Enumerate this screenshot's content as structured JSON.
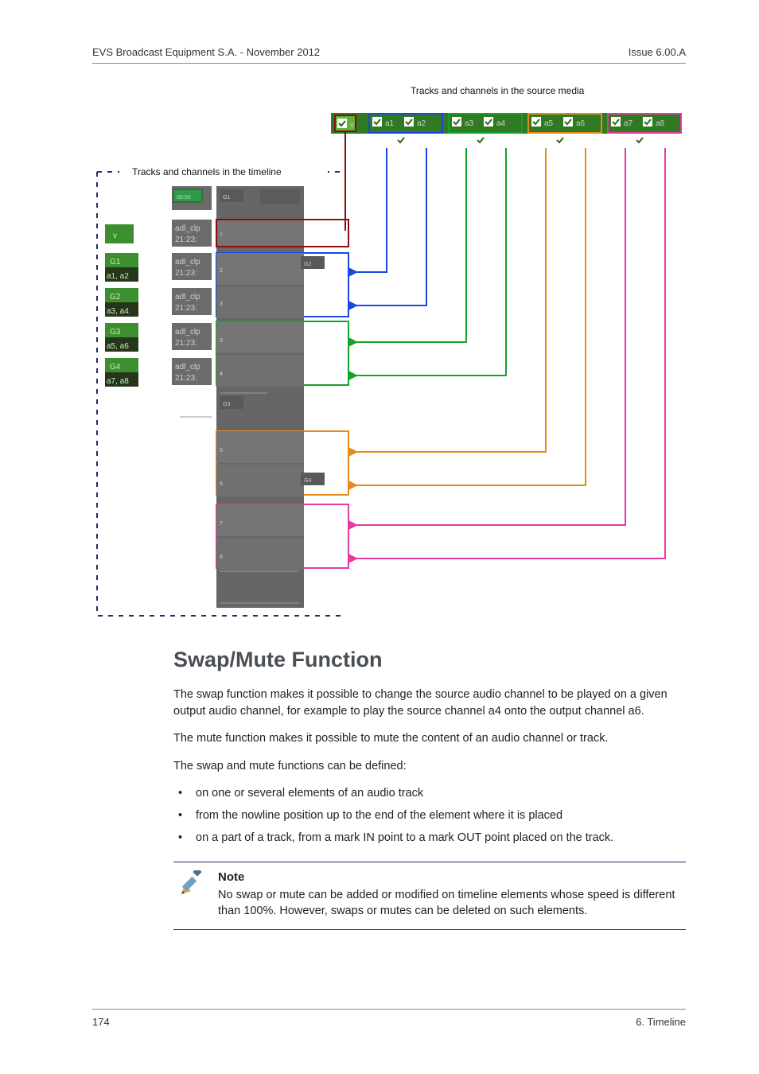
{
  "header": {
    "left": "EVS Broadcast Equipment S.A.  - November 2012",
    "right": "Issue 6.00.A"
  },
  "figure": {
    "caption_source": "Tracks and channels in the source media",
    "caption_timeline": "Tracks and channels in the timeline",
    "source_channels": [
      "v",
      "a1",
      "a2",
      "a3",
      "a4",
      "a5",
      "a6",
      "a7",
      "a8"
    ],
    "timeline_tracks": [
      {
        "group": "v",
        "sub": "",
        "clip": "adl_clp",
        "tc": "21:23:"
      },
      {
        "group": "G1",
        "sub": "a1, a2",
        "clip": "adl_clp",
        "tc": "21:23:"
      },
      {
        "group": "G2",
        "sub": "a3, a4",
        "clip": "adl_clp",
        "tc": "21:23:"
      },
      {
        "group": "G3",
        "sub": "a5, a6",
        "clip": "adl_clp",
        "tc": "21:23:"
      },
      {
        "group": "G4",
        "sub": "a7, a8",
        "clip": "adl_clp",
        "tc": "21:23:"
      }
    ],
    "top_time": "00:00",
    "rail_groups": [
      "G1",
      "G2",
      "G3",
      "G4"
    ]
  },
  "section": {
    "heading": "Swap/Mute Function",
    "p1": "The swap function makes it possible to change the source audio channel to be played on a given output audio channel, for example to play the source channel a4 onto the output channel a6.",
    "p2": "The mute function makes it possible to mute the content of an audio channel or track.",
    "p3": "The swap and mute functions can be defined:",
    "bullets": [
      "on one or several elements of an audio track",
      "from the nowline position up to the end of the element where it is placed",
      "on a part of a track, from a mark IN point to a mark OUT point placed on the track."
    ],
    "note": {
      "title": "Note",
      "text": "No swap or mute can be added or modified on timeline elements whose speed is different than 100%. However, swaps or mutes can be deleted on such elements."
    }
  },
  "footer": {
    "left": "174",
    "right": "6. Timeline"
  }
}
